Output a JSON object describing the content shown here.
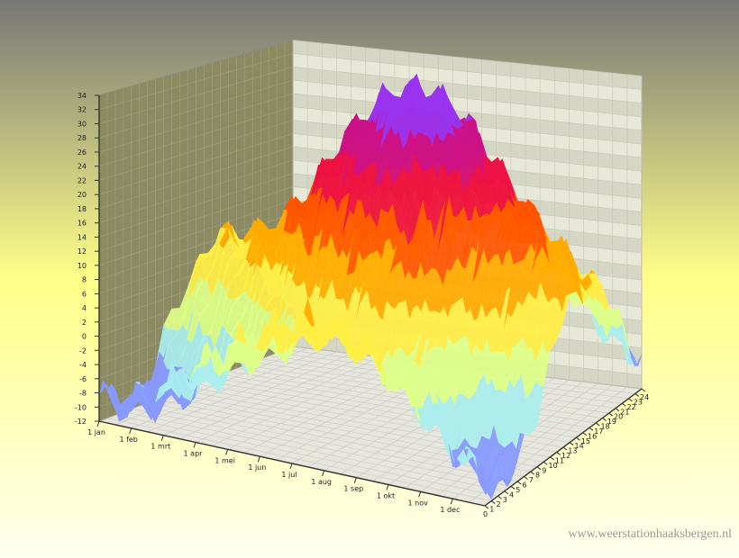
{
  "chart_data": {
    "type": "surface3d",
    "z_ticks": [
      "34",
      "32",
      "30",
      "28",
      "26",
      "24",
      "22",
      "20",
      "18",
      "16",
      "14",
      "12",
      "10",
      "8",
      "6",
      "4",
      "2",
      "0",
      "-2",
      "-4",
      "-6",
      "-8",
      "-10",
      "-12"
    ],
    "zlim": [
      -12,
      34
    ],
    "x_ticks": [
      "1 jan",
      "1 feb",
      "1 mrt",
      "1 apr",
      "1 mei",
      "1 jun",
      "1 jul",
      "1 aug",
      "1 sep",
      "1 okt",
      "1 nov",
      "1 dec"
    ],
    "y_ticks": [
      "0",
      "1",
      "2",
      "3",
      "4",
      "5",
      "6",
      "7",
      "8",
      "9",
      "10",
      "11",
      "12",
      "13",
      "14",
      "15",
      "16",
      "17",
      "18",
      "19",
      "20",
      "21",
      "22",
      "23",
      "24"
    ],
    "ylim": [
      0,
      24
    ],
    "x_count": 12,
    "surface_profile": [
      {
        "month": "1 jan",
        "min": -11,
        "max": 8
      },
      {
        "month": "1 feb",
        "min": -10,
        "max": 9
      },
      {
        "month": "1 mrt",
        "min": -7,
        "max": 12
      },
      {
        "month": "1 apr",
        "min": -3,
        "max": 18
      },
      {
        "month": "1 mei",
        "min": 0,
        "max": 26
      },
      {
        "month": "1 jun",
        "min": 3,
        "max": 32
      },
      {
        "month": "1 jul",
        "min": 5,
        "max": 34
      },
      {
        "month": "1 aug",
        "min": 4,
        "max": 31
      },
      {
        "month": "1 sep",
        "min": 1,
        "max": 24
      },
      {
        "month": "1 okt",
        "min": -3,
        "max": 18
      },
      {
        "month": "1 nov",
        "min": -8,
        "max": 13
      },
      {
        "month": "1 dec",
        "min": -11,
        "max": 9
      }
    ],
    "colors": {
      "bg_top": "#777777",
      "bg_mid": "#ffff88",
      "bg_bottom": "#fffff0",
      "wall_left": "#8c8a62",
      "wall_back": "#e8e8d8",
      "grid": "#c8c8c8",
      "axis": "#333333",
      "scale": [
        "#8899ff",
        "#aaeeee",
        "#ddff88",
        "#ffee44",
        "#ffaa00",
        "#ff5500",
        "#ee1144",
        "#cc1188",
        "#9933ee"
      ]
    }
  },
  "watermark": "www.weerstationhaaksbergen.nl"
}
